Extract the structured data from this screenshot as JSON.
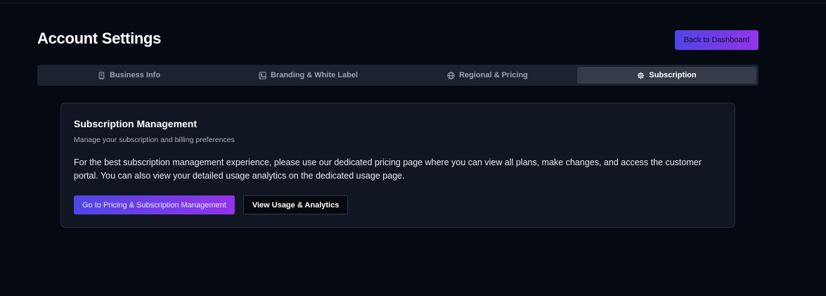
{
  "page": {
    "title": "Account Settings",
    "back_button": "Back to Dashboard"
  },
  "tabs": [
    {
      "label": "Business Info",
      "icon": "building-icon",
      "active": false
    },
    {
      "label": "Branding & White Label",
      "icon": "image-icon",
      "active": false
    },
    {
      "label": "Regional & Pricing",
      "icon": "globe-icon",
      "active": false
    },
    {
      "label": "Subscription",
      "icon": "gear-icon",
      "active": true
    }
  ],
  "subscription": {
    "title": "Subscription Management",
    "subtitle": "Manage your subscription and billing preferences",
    "body": "For the best subscription management experience, please use our dedicated pricing page where you can view all plans, make changes, and access the customer portal. You can also view your detailed usage analytics on the dedicated usage page.",
    "primary_button": "Go to Pricing & Subscription Management",
    "secondary_button": "View Usage & Analytics"
  },
  "colors": {
    "background": "#050911",
    "accent_start": "#4f46e5",
    "accent_end": "#9333ea",
    "card": "#111722",
    "active_tab": "#343c4a"
  }
}
